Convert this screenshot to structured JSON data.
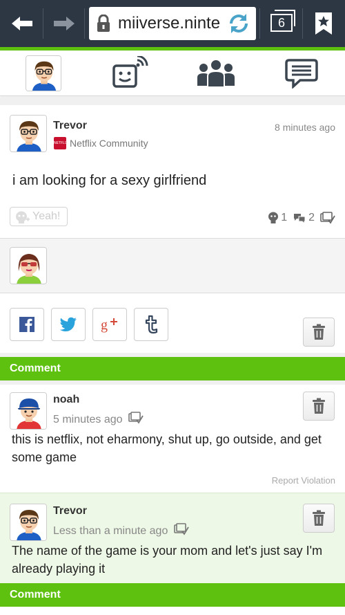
{
  "browser": {
    "url": "miiverse.ninte",
    "tab_count": "6"
  },
  "post": {
    "author": "Trevor",
    "time": "8 minutes ago",
    "community_icon_text": "NETFLIX",
    "community": "Netflix Community",
    "body": "i am looking for a sexy girlfriend",
    "yeah_label": "Yeah!",
    "yeah_count": "1",
    "comment_count": "2"
  },
  "comments_header": "Comment",
  "comments": [
    {
      "author": "noah",
      "time": "5 minutes ago",
      "body": "this is netflix, not eharmony, shut up, go outside, and get some game",
      "report": "Report Violation"
    },
    {
      "author": "Trevor",
      "time": "Less than a minute ago",
      "body": "The name of the game is your mom and let's just say I'm already playing it"
    }
  ],
  "footer_header": "Comment",
  "colors": {
    "browser_bar": "#2d3744",
    "accent_green": "#5fc10f",
    "netflix_red": "#c8102e"
  },
  "icons": [
    "back-arrow-icon",
    "forward-arrow-icon",
    "lock-icon",
    "reload-icon",
    "tabs-icon",
    "bookmark-icon",
    "activity-feed-icon",
    "communities-icon",
    "messages-icon",
    "yeah-icon",
    "comment-count-icon",
    "spoiler-icon",
    "facebook-icon",
    "twitter-icon",
    "google-plus-icon",
    "tumblr-icon",
    "trash-icon"
  ]
}
